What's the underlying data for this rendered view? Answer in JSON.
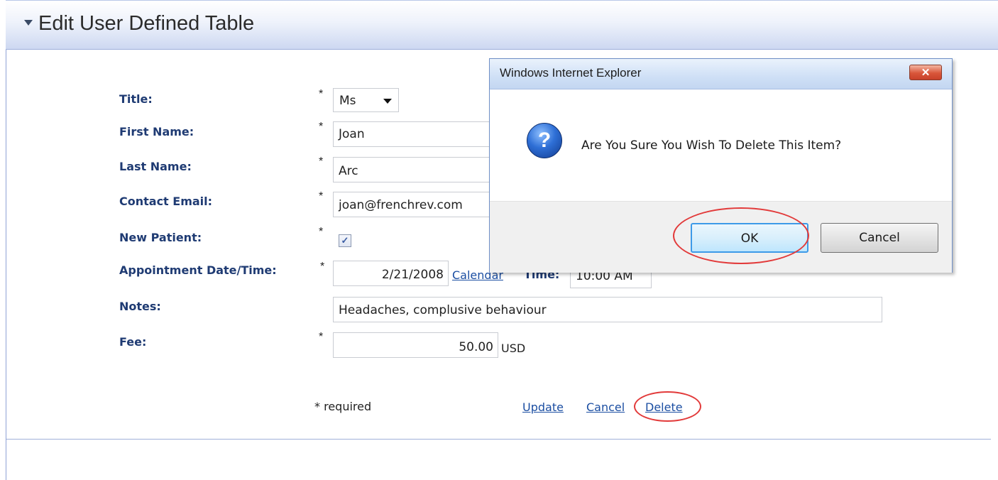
{
  "header": {
    "title": "Edit User Defined Table"
  },
  "form": {
    "title_label": "Title:",
    "title_value": "Ms",
    "first_name_label": "First Name:",
    "first_name_value": "Joan",
    "last_name_label": "Last Name:",
    "last_name_value": "Arc",
    "email_label": "Contact Email:",
    "email_value": "joan@frenchrev.com",
    "new_patient_label": "New Patient:",
    "new_patient_checked": true,
    "appt_label": "Appointment Date/Time:",
    "appt_date_value": "2/21/2008",
    "calendar_link": "Calendar",
    "time_label": "Time:",
    "time_value": "10:00 AM",
    "notes_label": "Notes:",
    "notes_value": "Headaches, complusive behaviour",
    "fee_label": "Fee:",
    "fee_value": "50.00",
    "fee_currency": "USD",
    "required_marker": "*",
    "required_note": "* required"
  },
  "actions": {
    "update": "Update",
    "cancel": "Cancel",
    "delete": "Delete"
  },
  "dialog": {
    "title": "Windows Internet Explorer",
    "close_glyph": "✕",
    "icon": "question-icon",
    "message": "Are You Sure You Wish To Delete This Item?",
    "ok_label": "OK",
    "cancel_label": "Cancel"
  },
  "colors": {
    "label": "#1f3b73",
    "link": "#1b4ea2",
    "highlight": "#e23a3a"
  }
}
